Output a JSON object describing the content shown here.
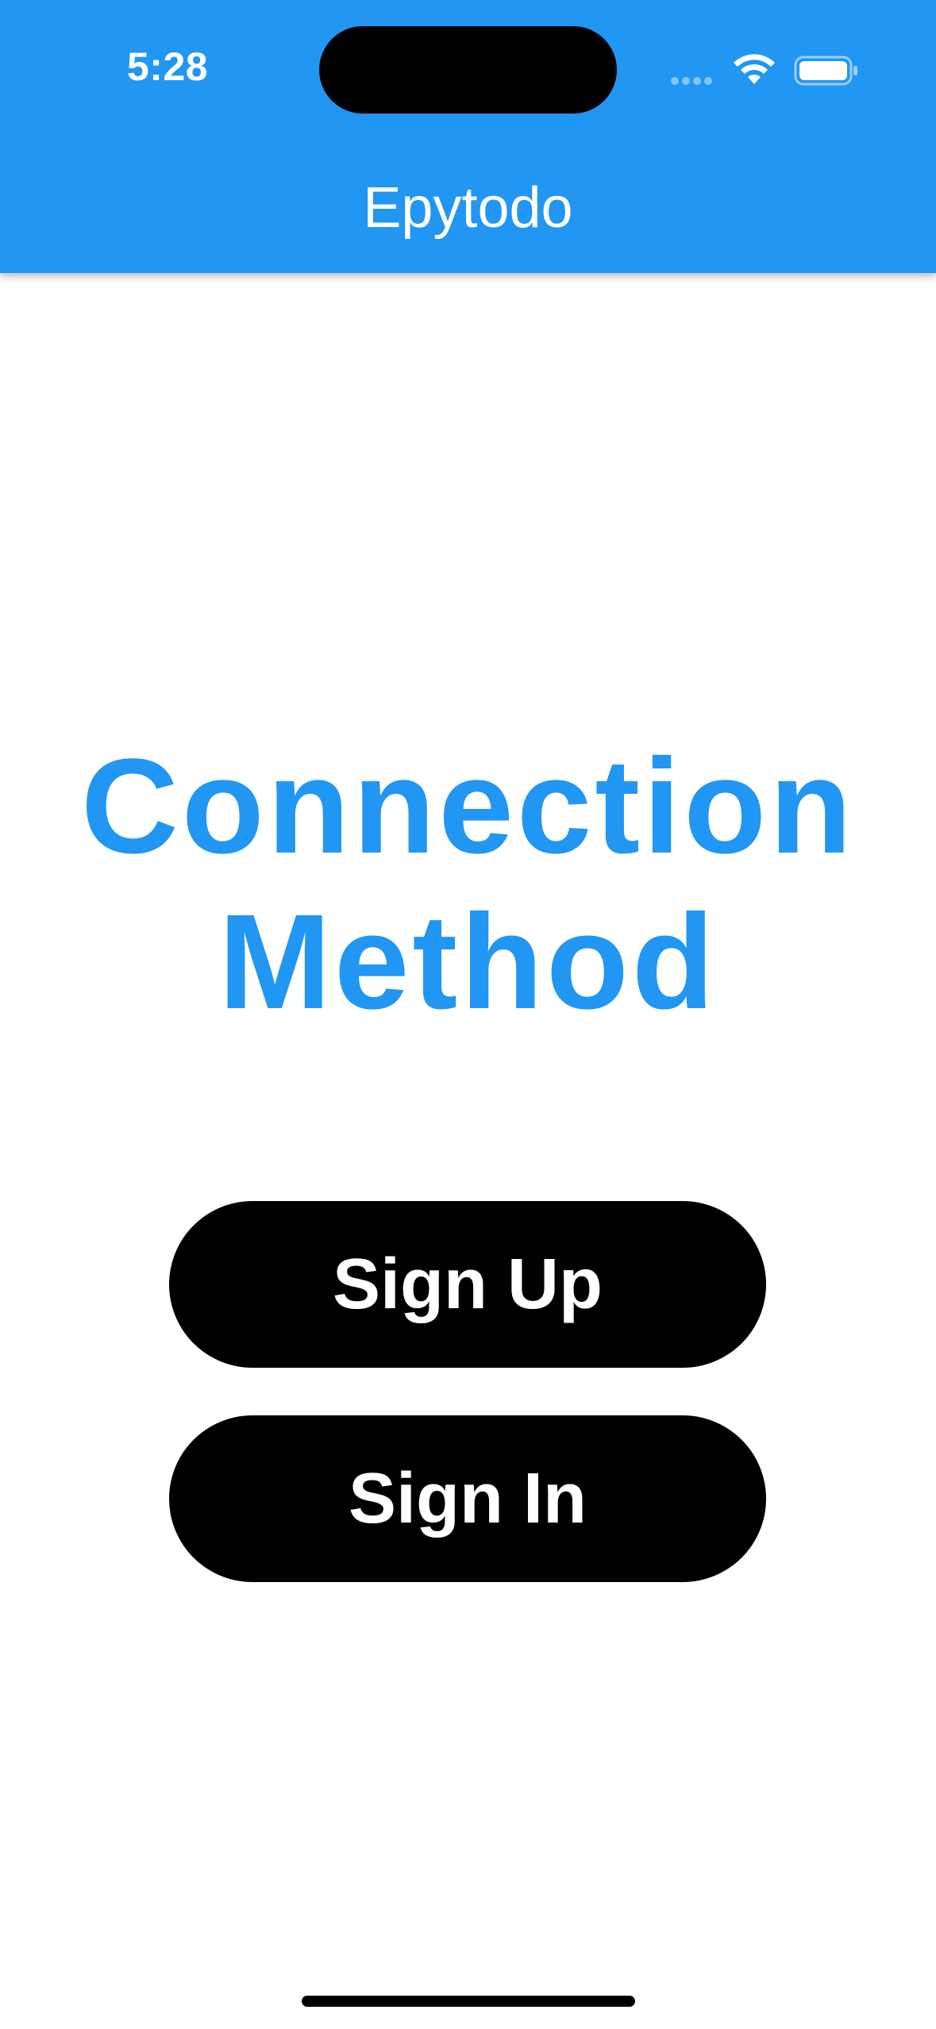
{
  "status_bar": {
    "time": "5:28",
    "icons": [
      "signal-dots-icon",
      "wifi-icon",
      "battery-icon"
    ]
  },
  "app_bar": {
    "title": "Epytodo",
    "background_color": "#2196F3"
  },
  "main": {
    "heading_line1": "Connection",
    "heading_line2": "Method",
    "heading_color": "#2196F3",
    "buttons": [
      {
        "label": "Sign Up"
      },
      {
        "label": "Sign In"
      }
    ],
    "button_color": "#000000"
  }
}
